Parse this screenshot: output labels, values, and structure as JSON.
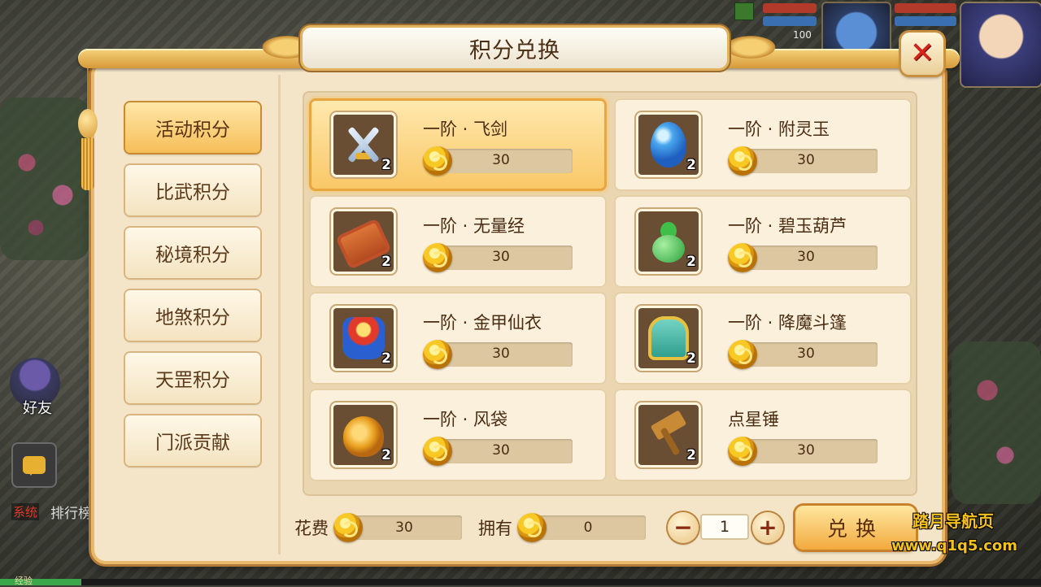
{
  "hud": {
    "pet_level": "100"
  },
  "panel": {
    "title": "积分兑换",
    "close_label": "✕"
  },
  "tabs": [
    {
      "label": "活动积分",
      "active": true
    },
    {
      "label": "比武积分",
      "active": false
    },
    {
      "label": "秘境积分",
      "active": false
    },
    {
      "label": "地煞积分",
      "active": false
    },
    {
      "label": "天罡积分",
      "active": false
    },
    {
      "label": "门派贡献",
      "active": false
    }
  ],
  "items": [
    {
      "name": "一阶 · 飞剑",
      "price": "30",
      "count": "2",
      "icon": "sword-icon",
      "selected": true
    },
    {
      "name": "一阶 · 附灵玉",
      "price": "30",
      "count": "2",
      "icon": "jade-icon",
      "selected": false
    },
    {
      "name": "一阶 · 无量经",
      "price": "30",
      "count": "2",
      "icon": "scroll-icon",
      "selected": false
    },
    {
      "name": "一阶 · 碧玉葫芦",
      "price": "30",
      "count": "2",
      "icon": "gourd-icon",
      "selected": false
    },
    {
      "name": "一阶 · 金甲仙衣",
      "price": "30",
      "count": "2",
      "icon": "armor-icon",
      "selected": false
    },
    {
      "name": "一阶 · 降魔斗篷",
      "price": "30",
      "count": "2",
      "icon": "cloak-icon",
      "selected": false
    },
    {
      "name": "一阶 · 风袋",
      "price": "30",
      "count": "2",
      "icon": "bag-icon",
      "selected": false
    },
    {
      "name": "点星锤",
      "price": "30",
      "count": "2",
      "icon": "hammer-icon",
      "selected": false
    }
  ],
  "footer": {
    "cost_label": "花费",
    "cost_value": "30",
    "owned_label": "拥有",
    "owned_value": "0",
    "minus_label": "−",
    "plus_label": "+",
    "quantity": "1",
    "exchange_label": "兑换"
  },
  "side": {
    "friends_label": "好友",
    "system_tag": "系统",
    "system_text": "排行榜",
    "exp_label": "经验"
  },
  "watermark": {
    "line1": "踏月导航页",
    "line2": "www.q1q5.com"
  },
  "colors": {
    "panel_bg": "#f4e5c8",
    "accent_gold": "#f6be58",
    "close_red": "#d8221a"
  }
}
